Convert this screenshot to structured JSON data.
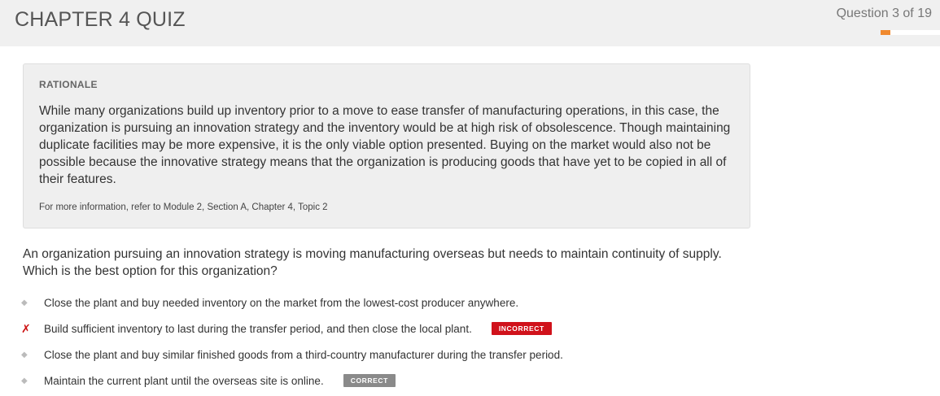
{
  "header": {
    "title": "CHAPTER 4 QUIZ",
    "question_counter": "Question 3 of 19",
    "progress_fraction": 0.158
  },
  "rationale": {
    "heading": "RATIONALE",
    "text": "While many organizations build up inventory prior to a move to ease transfer of manufacturing operations, in this case, the organization is pursuing an innovation strategy and the inventory would be at high risk of obsolescence. Though maintaining duplicate facilities may be more expensive, it is the only viable option presented. Buying on the market would also not be possible because the innovative strategy means that the organization is producing goods that have yet to be copied in all of their features.",
    "reference": "For more information, refer to Module 2, Section A, Chapter 4, Topic 2"
  },
  "question": {
    "text": "An organization pursuing an innovation strategy is moving manufacturing overseas but needs to maintain continuity of supply. Which is the best option for this organization?"
  },
  "answers": [
    {
      "text": "Close the plant and buy needed inventory on the market from the lowest-cost producer anywhere.",
      "marker": "◆",
      "badge": ""
    },
    {
      "text": "Build sufficient inventory to last during the transfer period, and then close the local plant.",
      "marker": "✗",
      "badge": "INCORRECT"
    },
    {
      "text": "Close the plant and buy similar finished goods from a third-country manufacturer during the transfer period.",
      "marker": "◆",
      "badge": ""
    },
    {
      "text": "Maintain the current plant until the overseas site is online.",
      "marker": "◆",
      "badge": "CORRECT"
    }
  ],
  "colors": {
    "accent": "#f0892e",
    "incorrect": "#d0121b",
    "correct": "#8a8a8a"
  }
}
